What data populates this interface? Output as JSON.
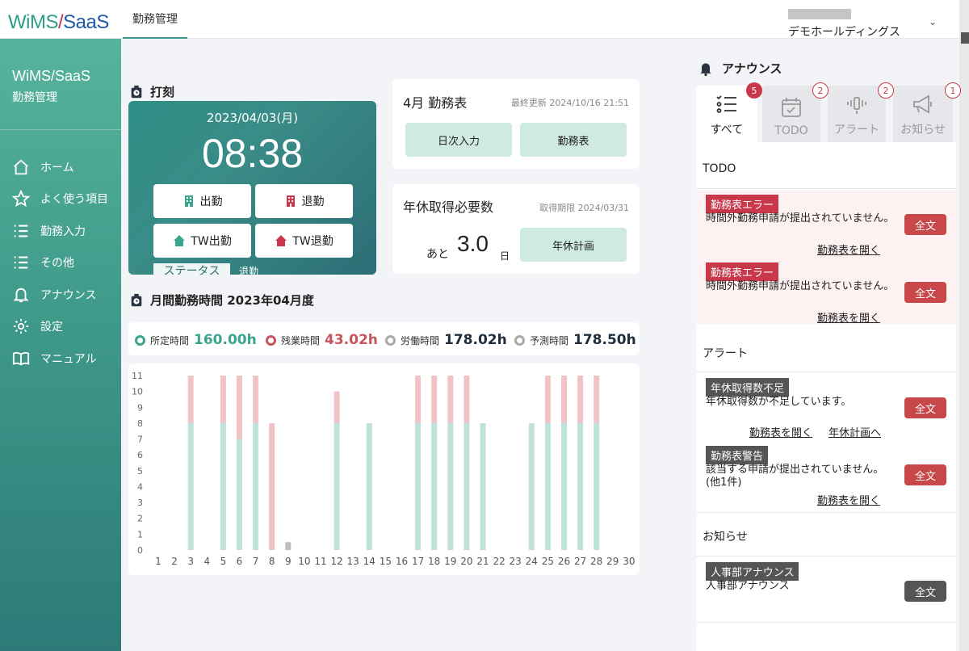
{
  "brand": {
    "part1": "WiMS",
    "slash": "/",
    "part2": "SaaS"
  },
  "header": {
    "tab": "勤務管理",
    "company": "デモホールディングス"
  },
  "sidebar": {
    "title": "WiMS/SaaS",
    "subtitle": "勤務管理",
    "items": [
      {
        "label": "ホーム",
        "icon": "home-icon"
      },
      {
        "label": "よく使う項目",
        "icon": "star-icon"
      },
      {
        "label": "勤務入力",
        "icon": "list-icon"
      },
      {
        "label": "その他",
        "icon": "list-icon"
      },
      {
        "label": "アナウンス",
        "icon": "bell-icon"
      },
      {
        "label": "設定",
        "icon": "gear-icon"
      },
      {
        "label": "マニュアル",
        "icon": "book-icon"
      }
    ]
  },
  "punch": {
    "title": "打刻",
    "date": "2023/04/03(月)",
    "time": "08:38",
    "buttons": {
      "clock_in": "出勤",
      "clock_out": "退勤",
      "tw_in": "TW出勤",
      "tw_out": "TW退勤"
    },
    "status_label": "ステータス",
    "status_value": "退勤"
  },
  "schedule": {
    "title": "4月 勤務表",
    "updated": "最終更新 2024/10/16 21:51",
    "daily_btn": "日次入力",
    "sheet_btn": "勤務表"
  },
  "leave": {
    "title": "年休取得必要数",
    "deadline": "取得期限 2024/03/31",
    "prefix": "あと",
    "value": "3.0",
    "unit": "日",
    "plan_btn": "年休計画"
  },
  "monthly": {
    "title": "月間勤務時間 2023年04月度",
    "legend": [
      {
        "label": "所定時間",
        "value": "160.00h",
        "color": "#3aa58f"
      },
      {
        "label": "残業時間",
        "value": "43.02h",
        "color": "#c8545e"
      },
      {
        "label": "労働時間",
        "value": "178.02h",
        "color": "#1f2d3d"
      },
      {
        "label": "予測時間",
        "value": "178.50h",
        "color": "#1f2d3d"
      }
    ]
  },
  "chart_data": {
    "type": "bar",
    "stacked": true,
    "x": [
      1,
      2,
      3,
      4,
      5,
      6,
      7,
      8,
      9,
      10,
      11,
      12,
      13,
      14,
      15,
      16,
      17,
      18,
      19,
      20,
      21,
      22,
      23,
      24,
      25,
      26,
      27,
      28,
      29,
      30
    ],
    "ylim": [
      0,
      11
    ],
    "yticks": [
      0,
      1,
      2,
      3,
      4,
      5,
      6,
      7,
      8,
      9,
      10,
      11
    ],
    "series": [
      {
        "name": "所定時間",
        "color": "#bfe3da",
        "values": [
          0,
          0,
          8,
          0,
          8,
          7,
          8,
          0,
          0,
          0,
          0,
          8,
          0,
          8,
          0,
          0,
          8,
          8,
          8,
          8,
          8,
          0,
          0,
          8,
          8,
          8,
          8,
          8,
          0,
          0
        ]
      },
      {
        "name": "残業時間",
        "color": "#f1c3c6",
        "values": [
          0,
          0,
          3,
          0,
          3,
          4,
          3,
          8,
          0,
          0,
          0,
          2,
          0,
          0,
          0,
          0,
          3,
          3,
          3,
          3,
          0,
          0,
          0,
          0,
          3,
          3,
          3,
          3,
          0,
          0
        ]
      },
      {
        "name": "予測時間",
        "color": "#bfbfbf",
        "values": [
          0,
          0,
          0,
          0,
          0,
          0,
          0,
          0,
          0.5,
          0,
          0,
          0,
          0,
          0,
          0,
          0,
          0,
          0,
          0,
          0,
          0,
          0,
          0,
          0,
          0,
          0,
          0,
          0,
          0,
          0
        ]
      }
    ]
  },
  "announce": {
    "title": "アナウンス",
    "tabs": [
      {
        "label": "すべて",
        "badge": "5",
        "icon": "checklist-icon"
      },
      {
        "label": "TODO",
        "badge": "2",
        "icon": "calendar-check-icon"
      },
      {
        "label": "アラート",
        "badge": "2",
        "icon": "vibrate-icon"
      },
      {
        "label": "お知らせ",
        "badge": "1",
        "icon": "megaphone-icon"
      }
    ],
    "groups": {
      "todo": "TODO",
      "alert": "アラート",
      "notice": "お知らせ"
    },
    "full_label": "全文",
    "todo_items": [
      {
        "tag": "勤務表エラー",
        "text": "時間外勤務申請が提出されていません。",
        "link": "勤務表を開く"
      },
      {
        "tag": "勤務表エラー",
        "text": "時間外勤務申請が提出されていません。",
        "link": "勤務表を開く"
      }
    ],
    "alert_items": [
      {
        "tag": "年休取得数不足",
        "text": "年休取得数が不足しています。",
        "link": "勤務表を開く",
        "link2": "年休計画へ"
      },
      {
        "tag": "勤務表警告",
        "text": "該当する申請が提出されていません。(他1件)",
        "link": "勤務表を開く"
      }
    ],
    "notice_items": [
      {
        "tag": "人事部アナウンス",
        "text": "人事部アナウンス"
      }
    ]
  }
}
